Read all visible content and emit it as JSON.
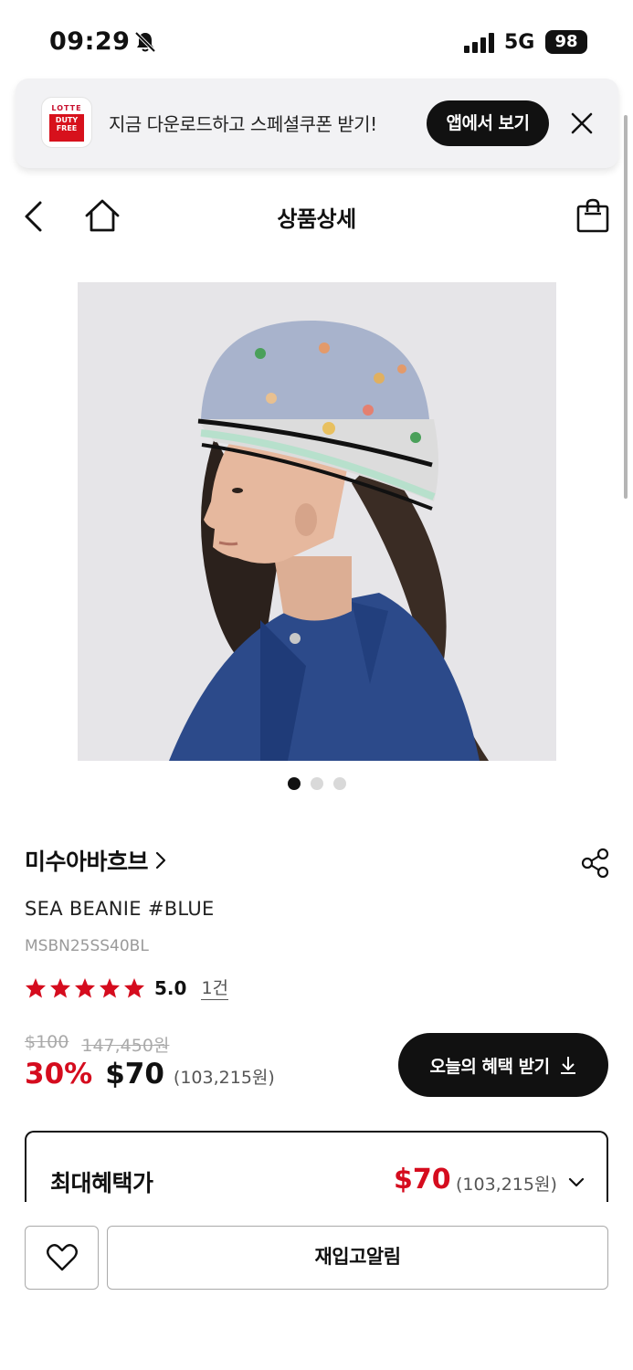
{
  "status_bar": {
    "time": "09:29",
    "network": "5G",
    "battery": "98"
  },
  "app_banner": {
    "logo_brand": "LOTTE",
    "logo_line1": "DUTY",
    "logo_line2": "FREE",
    "message": "지금 다운로드하고 스페셜쿠폰 받기!",
    "open_app_label": "앱에서 보기"
  },
  "header": {
    "title": "상품상세"
  },
  "gallery": {
    "image_count": 3,
    "active_index": 0
  },
  "product": {
    "brand": "미수아바흐브",
    "name": "SEA BEANIE #BLUE",
    "code": "MSBN25SS40BL",
    "rating": "5.0",
    "rating_fraction": 1.0,
    "review_count": "1건",
    "original_price_usd": "$100",
    "original_price_krw": "147,450원",
    "discount": "30%",
    "sale_price_usd": "$70",
    "sale_price_krw": "(103,215원)",
    "benefit_button_label": "오늘의 혜택 받기"
  },
  "max_benefit": {
    "label": "최대혜택가",
    "price_usd": "$70",
    "price_krw": "(103,215원)"
  },
  "bottom_bar": {
    "restock_label": "재입고알림"
  },
  "colors": {
    "accent_red": "#d50c1e",
    "primary_black": "#111111"
  }
}
